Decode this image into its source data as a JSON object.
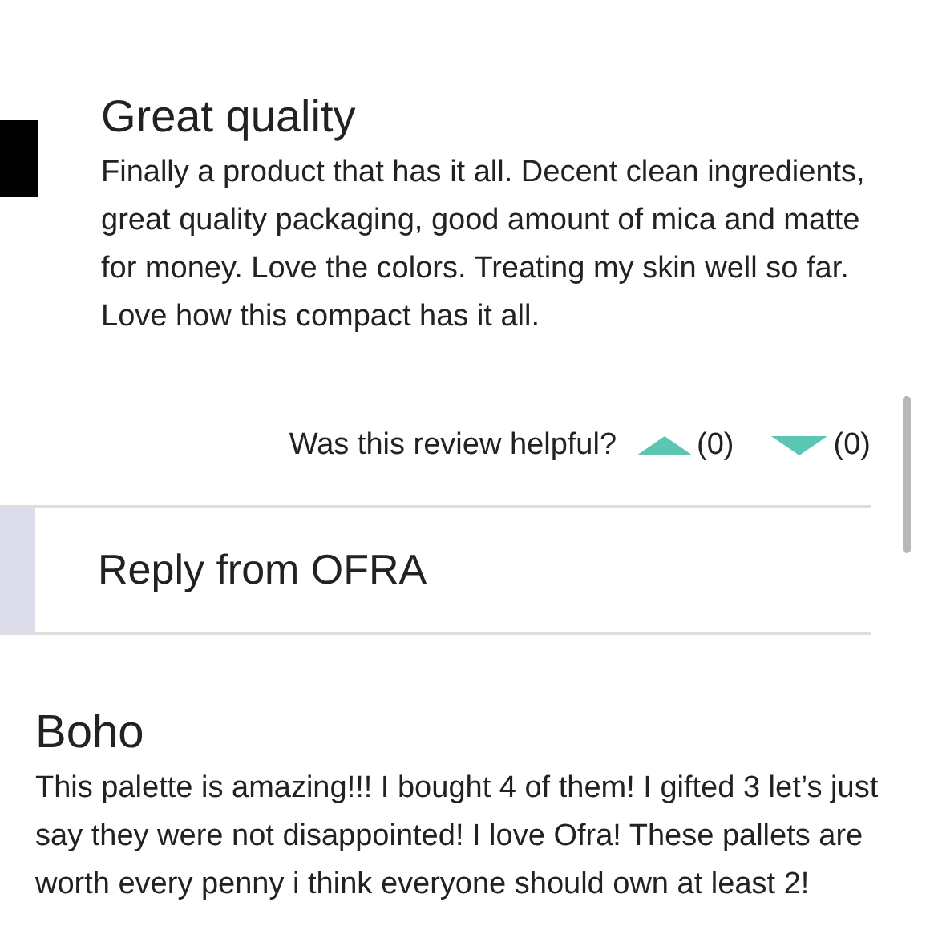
{
  "review": {
    "title": "Great quality",
    "body": "Finally a product that has it all. Decent clean ingredients, great quality packaging, good amount of mica and matte for money. Love the colors. Treating my skin well so far. Love how this compact has it all.",
    "helpful_prompt": "Was this review helpful?",
    "upvotes": "(0)",
    "downvotes": "(0)"
  },
  "reply": {
    "label": "Reply from OFRA"
  },
  "next_review": {
    "title": "Boho",
    "body": "This palette is amazing!!! I bought 4 of them! I gifted 3 let’s just say they were not disappointed! I love Ofra! These pallets are worth every penny i think everyone should own at least 2!"
  }
}
